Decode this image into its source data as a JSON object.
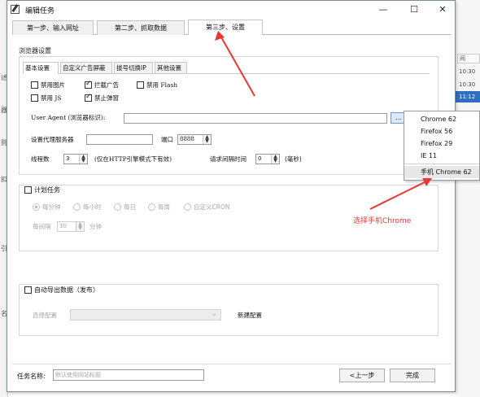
{
  "window": {
    "title": "编辑任务",
    "minimize": "—",
    "maximize": "☐",
    "close": "✕"
  },
  "tabs": [
    {
      "label": "第一步、输入网址"
    },
    {
      "label": "第二步、抓取数据"
    },
    {
      "label": "第三步、设置"
    }
  ],
  "browser": {
    "section_label": "浏览器设置",
    "subtabs": [
      {
        "label": "基本设置"
      },
      {
        "label": "自定义广告屏蔽"
      },
      {
        "label": "拔号切换IP"
      },
      {
        "label": "其他设置"
      }
    ],
    "checkboxes": {
      "disable_images": {
        "label": "禁用图片",
        "checked": false
      },
      "block_ads": {
        "label": "拦截广告",
        "checked": true
      },
      "disable_flash": {
        "label": "禁用 Flash",
        "checked": false
      },
      "disable_js": {
        "label": "禁用 JS",
        "checked": false
      },
      "block_popups": {
        "label": "禁止弹窗",
        "checked": true
      }
    },
    "user_agent_label": "User Agent (浏览器标识):",
    "ua_button": "...",
    "proxy_label": "设置代理服务器",
    "port_label": "端口",
    "port_value": "8888",
    "threads_label": "线程数",
    "threads_value": "3",
    "threads_note": "(仅在HTTP引擎模式下有效)",
    "interval_label": "请求间隔时间",
    "interval_value": "0",
    "interval_unit": "(毫秒)"
  },
  "ua_dropdown": {
    "items": [
      "Chrome 62",
      "Firefox 56",
      "Firefox 29",
      "IE 11",
      "手机 Chrome 62"
    ],
    "selected_index": 4
  },
  "schedule": {
    "label": "计划任务",
    "checked": false,
    "radios": [
      "每分钟",
      "每小时",
      "每日",
      "每周",
      "自定义CRON"
    ],
    "selected_radio": 0,
    "every_label": "每间隔",
    "every_value": "30",
    "every_unit": "分钟"
  },
  "export": {
    "label": "自动导出数据（发布）",
    "checked": false,
    "config_label": "选择配置",
    "new_config": "新建配置"
  },
  "footer": {
    "task_name_label": "任务名称:",
    "task_name_placeholder": "默认使用网站标题",
    "prev_button": "<上一步",
    "finish_button": "完成"
  },
  "annotation": {
    "text": "选择手机Chrome",
    "color": "#e53935"
  },
  "background": {
    "right_header": "间",
    "times": [
      "10:30",
      "10:30",
      "11:12"
    ]
  }
}
